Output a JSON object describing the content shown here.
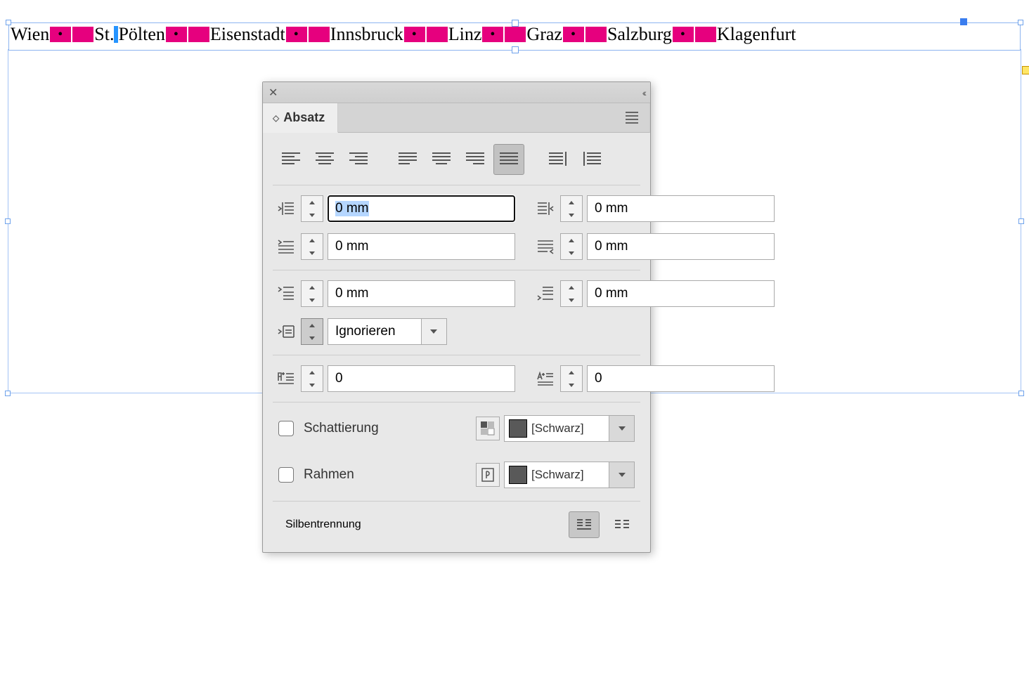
{
  "cities": [
    "Wien",
    "St.",
    "Pölten",
    "Eisenstadt",
    "Innsbruck",
    "Linz",
    "Graz",
    "Salzburg",
    "Klagenfurt"
  ],
  "panel": {
    "title": "Absatz",
    "indent_left": "0 mm",
    "indent_right": "0 mm",
    "first_line": "0 mm",
    "last_line": "0 mm",
    "space_before": "0 mm",
    "space_after": "0 mm",
    "grid_align": "Ignorieren",
    "drop_cap_lines": "0",
    "drop_cap_chars": "0",
    "shading_label": "Schattierung",
    "border_label": "Rahmen",
    "hyphenation_label": "Silbentrennung",
    "shading_color": "[Schwarz]",
    "border_color": "[Schwarz]"
  }
}
